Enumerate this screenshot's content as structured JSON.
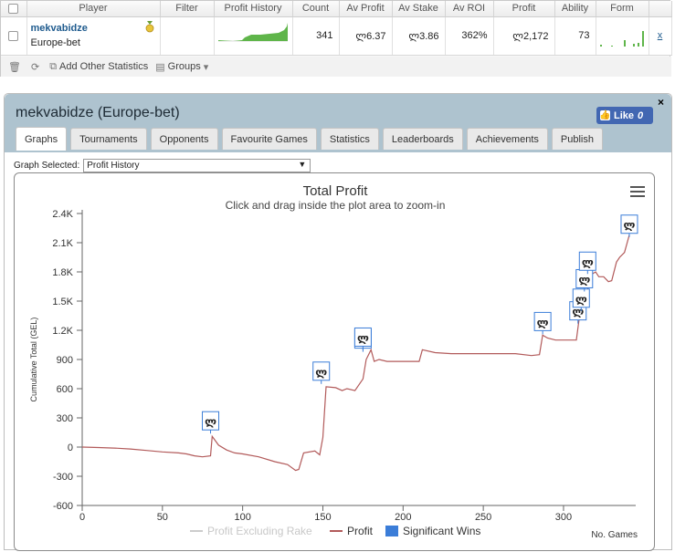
{
  "table": {
    "headers": [
      "",
      "Player",
      "Filter",
      "Profit History",
      "Count",
      "Av Profit",
      "Av Stake",
      "Av ROI",
      "Profit",
      "Ability",
      "Form",
      ""
    ],
    "row": {
      "player_name": "mekvabidze",
      "player_site": "Europe-bet",
      "count": "341",
      "av_profit": "ლ6.37",
      "av_stake": "ლ3.86",
      "av_roi": "362%",
      "profit": "ლ2,172",
      "ability": "73",
      "remove": "x"
    }
  },
  "toolbar": {
    "add_stats": "Add Other Statistics",
    "groups": "Groups"
  },
  "panel": {
    "title": "mekvabidze (Europe-bet)",
    "like_label": "Like",
    "like_count": "0",
    "close": "×",
    "tabs": [
      "Graphs",
      "Tournaments",
      "Opponents",
      "Favourite Games",
      "Statistics",
      "Leaderboards",
      "Achievements",
      "Publish"
    ],
    "graph_selected_label": "Graph Selected:",
    "graph_selected_value": "Profit History"
  },
  "chart_data": {
    "type": "line",
    "title": "Total Profit",
    "subtitle": "Click and drag inside the plot area to zoom-in",
    "xlabel": "No. Games",
    "ylabel": "Cumulative Total (GEL)",
    "xlim": [
      0,
      345
    ],
    "ylim": [
      -600,
      2400
    ],
    "x_ticks": [
      0,
      50,
      100,
      150,
      200,
      250,
      300
    ],
    "y_ticks": [
      -600,
      -300,
      0,
      300,
      600,
      900,
      1200,
      1500,
      1800,
      2100,
      2400
    ],
    "y_tick_labels": [
      "-600",
      "-300",
      "0",
      "300",
      "600",
      "900",
      "1.2K",
      "1.5K",
      "1.8K",
      "2.1K",
      "2.4K"
    ],
    "legend": [
      "Profit Excluding Rake",
      "Profit",
      "Significant Wins"
    ],
    "colors": {
      "profit": "#b25a5a",
      "excl_rake": "#cccccc",
      "sig": "#3b7dd8"
    },
    "series": [
      {
        "name": "Profit",
        "x": [
          0,
          10,
          20,
          30,
          40,
          50,
          60,
          65,
          70,
          75,
          80,
          81,
          85,
          90,
          95,
          100,
          110,
          120,
          128,
          133,
          135,
          138,
          145,
          148,
          150,
          152,
          158,
          162,
          165,
          170,
          175,
          177,
          180,
          182,
          185,
          190,
          200,
          210,
          212,
          220,
          230,
          240,
          250,
          260,
          270,
          280,
          285,
          287,
          290,
          295,
          300,
          305,
          308,
          310,
          312,
          314,
          316,
          318,
          320,
          322,
          325,
          328,
          330,
          333,
          335,
          338,
          341
        ],
        "y": [
          0,
          -5,
          -10,
          -20,
          -35,
          -50,
          -60,
          -70,
          -90,
          -100,
          -90,
          110,
          20,
          -30,
          -60,
          -70,
          -100,
          -150,
          -180,
          -240,
          -230,
          -60,
          -40,
          -80,
          100,
          620,
          610,
          580,
          600,
          580,
          700,
          900,
          1000,
          880,
          900,
          880,
          880,
          880,
          1000,
          970,
          960,
          960,
          960,
          960,
          960,
          940,
          950,
          1150,
          1120,
          1100,
          1100,
          1100,
          1100,
          1350,
          1500,
          1520,
          1700,
          1780,
          1800,
          1750,
          1750,
          1700,
          1710,
          1900,
          1950,
          2000,
          2180
        ]
      },
      {
        "name": "Significant Wins",
        "x": [
          80,
          149,
          175,
          175,
          287,
          309,
          311,
          313,
          315,
          341
        ],
        "y": [
          270,
          780,
          1110,
          1130,
          1290,
          1400,
          1530,
          1730,
          1910,
          2290
        ]
      }
    ],
    "marker_symbol": "ლ"
  }
}
